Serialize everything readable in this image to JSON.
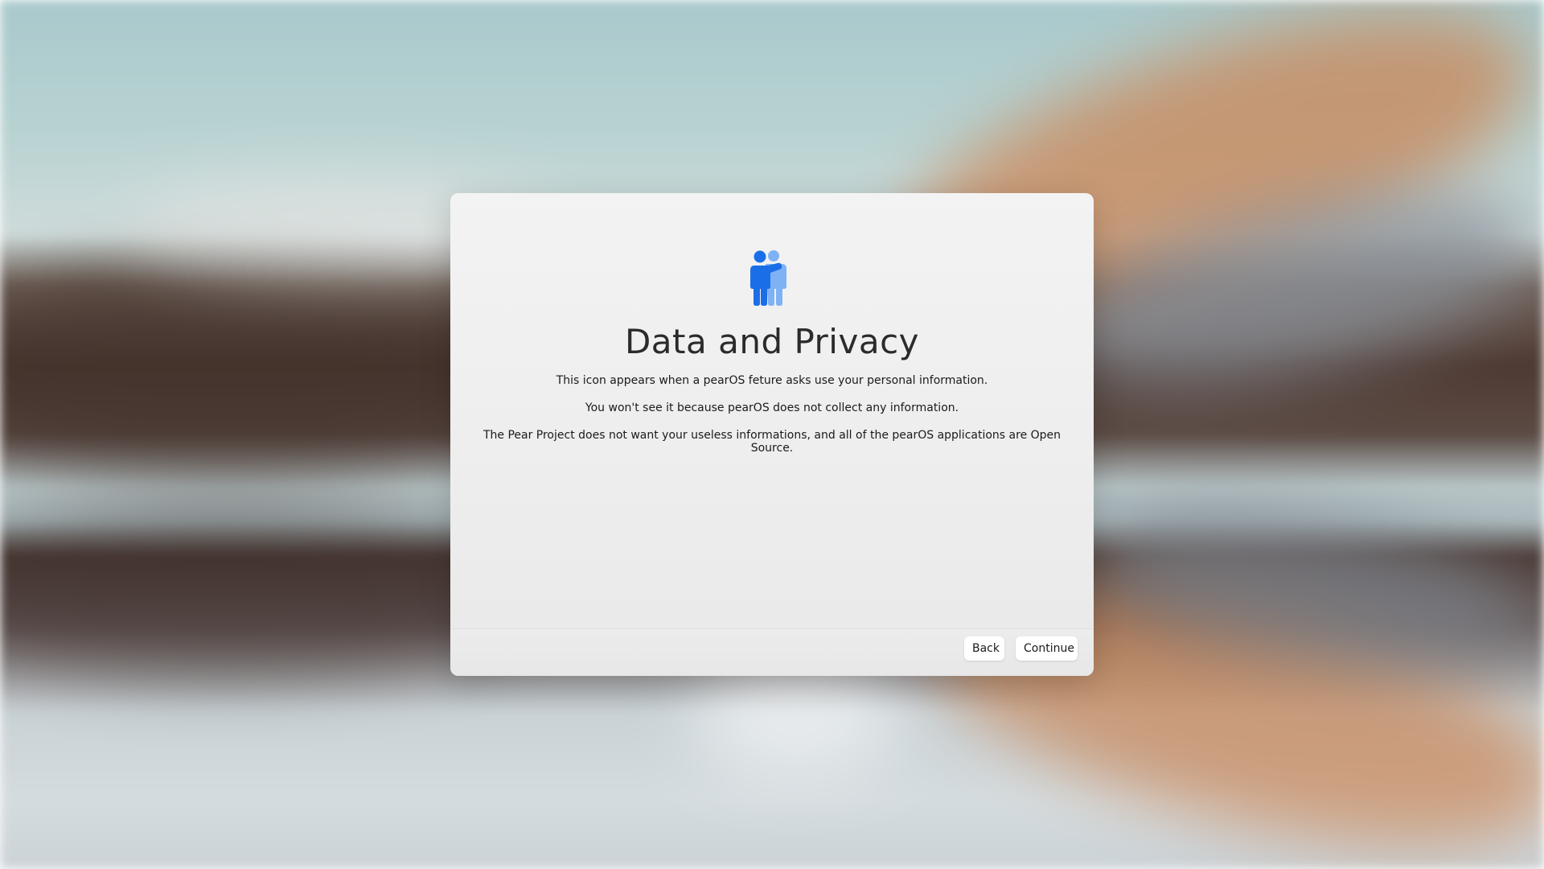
{
  "dialog": {
    "icon": "people-privacy-icon",
    "icon_colors": {
      "front": "#1a6fe8",
      "back": "#7fb2f5"
    },
    "title": "Data and Privacy",
    "paragraphs": [
      "This icon appears when a pearOS feture asks use your personal information.",
      "You won't see it because pearOS does not collect any information.",
      "The Pear Project does not want your useless informations, and all of the pearOS applications are Open Source."
    ],
    "buttons": {
      "back": "Back",
      "continue": "Continue"
    }
  }
}
